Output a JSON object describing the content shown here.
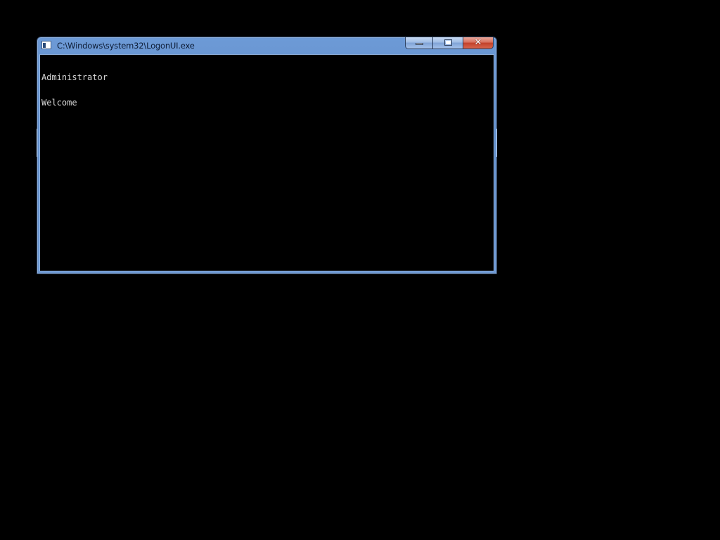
{
  "window": {
    "title": "C:\\Windows\\system32\\LogonUI.exe",
    "icon": "console-window-icon",
    "buttons": {
      "minimize": "minimize-icon",
      "maximize": "maximize-icon",
      "close_glyph": "✕"
    }
  },
  "console": {
    "lines": [
      "Administrator",
      "Welcome"
    ]
  },
  "colors": {
    "desktop": "#000000",
    "console_bg": "#000000",
    "console_text": "#d9d9d9",
    "title_bar": "#6d9ad6",
    "close_button": "#c2412a"
  }
}
